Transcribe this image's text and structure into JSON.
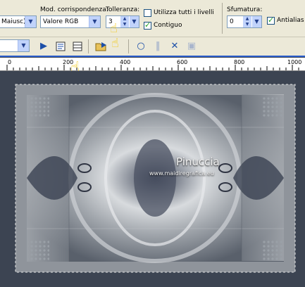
{
  "toolbar": {
    "case_value": "Maiusc)",
    "mode_label": "Mod. corrispondenza:",
    "mode_value": "Valore RGB",
    "tolerance_label": "Tolleranza:",
    "tolerance_value": "3",
    "use_all_layers_label": "Utilizza tutti i livelli",
    "use_all_layers_checked": false,
    "contiguous_label": "Contiguo",
    "contiguous_checked": true,
    "feather_label": "Sfumatura:",
    "feather_value": "0",
    "antialias_label": "Antialias",
    "antialias_checked": true
  },
  "toolbar2": {
    "icons": [
      "play-icon",
      "script-icon",
      "list-icon",
      "folder-run-icon",
      "record-icon",
      "pause-icon",
      "stop-icon",
      "save-icon"
    ]
  },
  "ruler": {
    "labels": [
      "0",
      "200",
      "400",
      "600",
      "800",
      "1000"
    ]
  },
  "watermark": {
    "name": "Pinuccia",
    "url": "www.maidiregrafica.eu"
  },
  "colors": {
    "toolbar_bg": "#ece9d8",
    "workspace_bg": "#3c4452",
    "highlight": "#f2c400"
  }
}
